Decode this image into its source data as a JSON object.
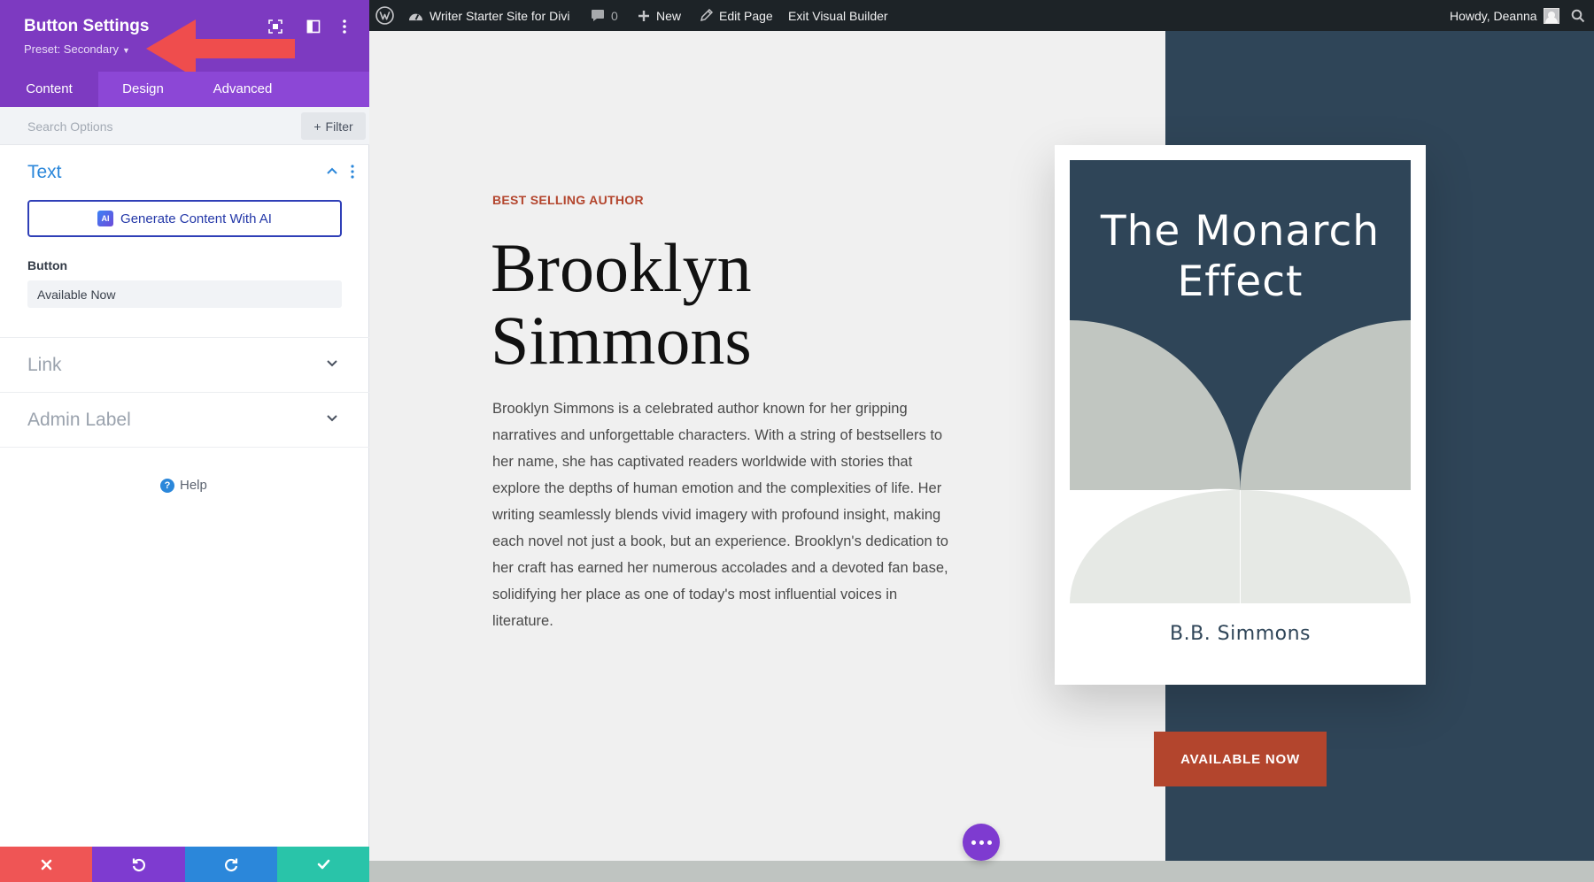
{
  "panel": {
    "title": "Button Settings",
    "preset": "Preset: Secondary",
    "tabs": {
      "content": "Content",
      "design": "Design",
      "advanced": "Advanced"
    },
    "search_placeholder": "Search Options",
    "filter_label": "Filter",
    "sections": {
      "text": "Text",
      "link": "Link",
      "admin": "Admin Label"
    },
    "ai_button_label": "Generate Content With AI",
    "ai_badge": "AI",
    "button_field_label": "Button",
    "button_field_value": "Available Now",
    "help_label": "Help",
    "accent_color": "#7d3ac1"
  },
  "adminbar": {
    "site_name": "Writer Starter Site for Divi",
    "comment_count": "0",
    "new_label": "New",
    "edit_label": "Edit Page",
    "exit_label": "Exit Visual Builder",
    "howdy": "Howdy, Deanna"
  },
  "page": {
    "eyebrow": "BEST SELLING AUTHOR",
    "name_line1": "Brooklyn",
    "name_line2": "Simmons",
    "bio": "Brooklyn Simmons is a celebrated author known for her gripping narratives and unforgettable characters. With a string of bestsellers to her name, she has captivated readers worldwide with stories that explore the depths of human emotion and the complexities of life. Her writing seamlessly blends vivid imagery with profound insight, making each novel not just a book, but an experience. Brooklyn's dedication to her craft has earned her numerous accolades and a devoted fan base, solidifying her place as one of today's most influential voices in literature.",
    "book_title_line1": "The Monarch",
    "book_title_line2": "Effect",
    "book_author": "B.B. Simmons",
    "cta_label": "AVAILABLE NOW",
    "accent_color": "#b3452d",
    "dark_color": "#2f4558"
  }
}
